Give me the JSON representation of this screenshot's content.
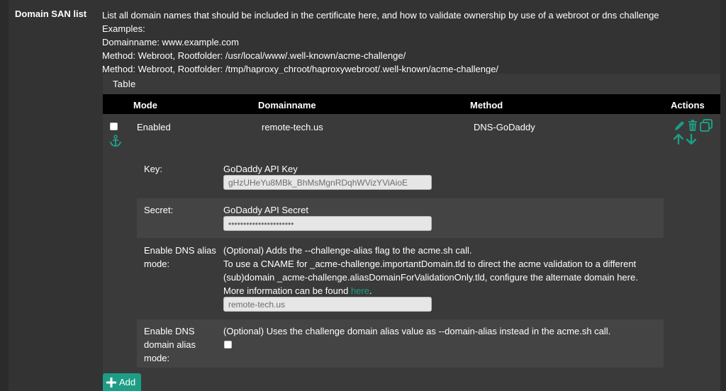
{
  "field": {
    "label": "Domain SAN list",
    "help": [
      "List all domain names that should be included in the certificate here, and how to validate ownership by use of a webroot or dns challenge",
      "Examples:",
      "Domainname: www.example.com",
      "Method: Webroot, Rootfolder: /usr/local/www/.well-known/acme-challenge/",
      "Method: Webroot, Rootfolder: /tmp/haproxy_chroot/haproxywebroot/.well-known/acme-challenge/"
    ]
  },
  "table": {
    "title": "Table",
    "headers": {
      "mode": "Mode",
      "domain": "Domainname",
      "method": "Method",
      "actions": "Actions"
    },
    "row": {
      "mode": "Enabled",
      "domain": "remote-tech.us",
      "method": "DNS-GoDaddy",
      "checked": false
    }
  },
  "details": {
    "key": {
      "label": "Key:",
      "title": "GoDaddy API Key",
      "value": "gHzUHeYu8MBk_BhMsMgnRDqhWVizYViAioE"
    },
    "secret": {
      "label": "Secret:",
      "title": "GoDaddy API Secret",
      "value": "••••••••••••••••••••••"
    },
    "alias": {
      "label_lines": [
        "Enable DNS alias",
        "mode:"
      ],
      "lines": [
        "(Optional) Adds the --challenge-alias flag to the acme.sh call.",
        "To use a CNAME for _acme-challenge.importantDomain.tld to direct the acme validation to a different",
        "(sub)domain _acme-challenge.aliasDomainForValidationOnly.tld, configure the alternate domain here."
      ],
      "more_prefix": "More information can be found ",
      "more_link": "here",
      "more_suffix": ".",
      "value": "remote-tech.us"
    },
    "domain_alias": {
      "label_lines": [
        "Enable DNS",
        "domain alias",
        "mode:"
      ],
      "text": "(Optional) Uses the challenge domain alias value as --domain-alias instead in the acme.sh call.",
      "checked": false
    }
  },
  "add_button": {
    "label": "Add"
  },
  "icons": [
    "anchor-icon",
    "pencil-icon",
    "trash-icon",
    "copy-icon",
    "arrow-up-icon",
    "arrow-down-icon",
    "plus-icon"
  ],
  "colors": {
    "accent": "#1d9d85",
    "background": "#333333",
    "header": "#000000"
  }
}
